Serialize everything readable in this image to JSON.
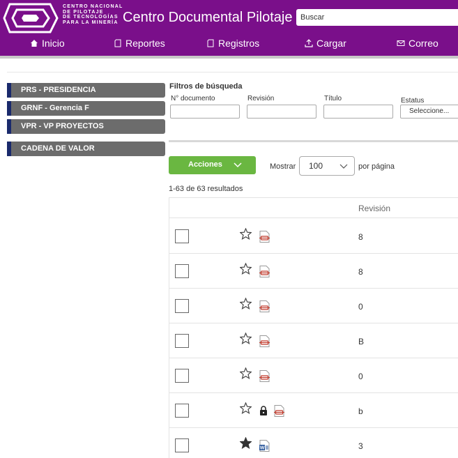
{
  "header": {
    "logo_lines": [
      "CENTRO NACIONAL",
      "DE PILOTAJE",
      "DE TECNOLOGÍAS",
      "PARA LA MINERÍA"
    ],
    "app_title": "Centro Documental Pilotaje",
    "search_placeholder": "Buscar",
    "brand_color": "#7a0f8a"
  },
  "nav": [
    {
      "label": "Inicio",
      "icon": "home-icon"
    },
    {
      "label": "Reportes",
      "icon": "document-icon"
    },
    {
      "label": "Registros",
      "icon": "document-icon"
    },
    {
      "label": "Cargar",
      "icon": "upload-icon"
    },
    {
      "label": "Correo",
      "icon": "mail-icon"
    }
  ],
  "sidebar": {
    "items": [
      {
        "label": "PRS - PRESIDENCIA"
      },
      {
        "label": "GRNF - Gerencia F"
      },
      {
        "label": "VPR - VP PROYECTOS"
      },
      {
        "label": "CADENA DE VALOR"
      }
    ]
  },
  "filters": {
    "title": "Filtros de búsqueda",
    "fields": [
      {
        "label": "N° documento",
        "value": ""
      },
      {
        "label": "Revisión",
        "value": ""
      },
      {
        "label": "Título",
        "value": ""
      },
      {
        "label": "Estatus",
        "value": "Seleccione..."
      }
    ]
  },
  "toolbar": {
    "actions_label": "Acciones",
    "show_label": "Mostrar",
    "page_size": "100",
    "per_page_label": "por página",
    "results_text": "1-63 de 63 resultados"
  },
  "table": {
    "columns": [
      "Revisión"
    ],
    "rows": [
      {
        "starred": false,
        "locked": false,
        "file_type": "pdf",
        "revision": "8"
      },
      {
        "starred": false,
        "locked": false,
        "file_type": "pdf",
        "revision": "8"
      },
      {
        "starred": false,
        "locked": false,
        "file_type": "pdf",
        "revision": "0"
      },
      {
        "starred": false,
        "locked": false,
        "file_type": "pdf",
        "revision": "B"
      },
      {
        "starred": false,
        "locked": false,
        "file_type": "pdf",
        "revision": "0"
      },
      {
        "starred": false,
        "locked": true,
        "file_type": "pdf",
        "revision": "b"
      },
      {
        "starred": true,
        "locked": false,
        "file_type": "word",
        "revision": "3"
      }
    ]
  }
}
